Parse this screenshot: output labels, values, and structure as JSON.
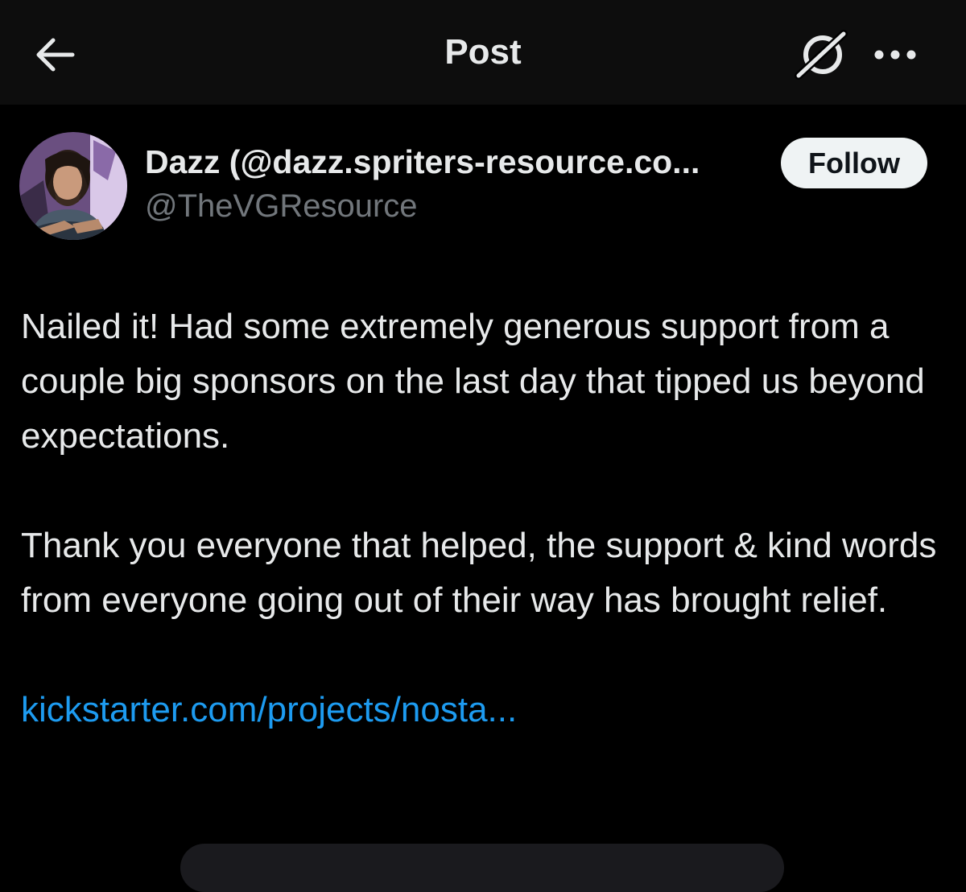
{
  "header": {
    "title": "Post",
    "back_icon": "arrow-left-icon",
    "grok_icon": "grok-icon",
    "more_icon": "more-horizontal-icon"
  },
  "author": {
    "display_name": "Dazz (@dazz.spriters-resource.co...",
    "handle": "@TheVGResource",
    "avatar_icon": "user-avatar",
    "follow_label": "Follow"
  },
  "post": {
    "paragraph_1": "Nailed it! Had some extremely generous support from a couple big sponsors on the last day that tipped us beyond expectations.",
    "paragraph_2": "Thank you everyone that helped, the support & kind words from everyone going out of their way has brought relief.",
    "link_text": "kickstarter.com/projects/nosta..."
  },
  "colors": {
    "background": "#000000",
    "header_background": "#0d0d0d",
    "text_primary": "#e7e9ea",
    "text_secondary": "#71767b",
    "link": "#1d9bf0",
    "follow_button_bg": "#eff3f4",
    "follow_button_text": "#0f1419"
  }
}
